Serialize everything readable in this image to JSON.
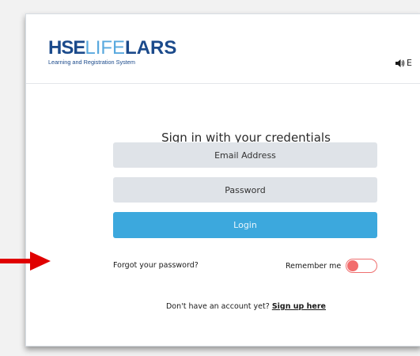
{
  "header": {
    "logo_part1": "HSE",
    "logo_part2": "LIFE",
    "logo_part3": "LARS",
    "logo_subtitle": "Learning and Registration System",
    "language_label": "E"
  },
  "login": {
    "heading": "Sign in with your credentials",
    "email_placeholder": "Email Address",
    "password_placeholder": "Password",
    "login_label": "Login",
    "forgot_label": "Forgot your password?",
    "remember_label": "Remember me",
    "remember_on": false,
    "signup_prompt": "Don't have an account yet?",
    "signup_link": "Sign up here"
  },
  "colors": {
    "logo_dark": "#1b4a8b",
    "logo_light": "#59a9de",
    "primary_button": "#3ca8dd",
    "field_bg": "#dfe3e8",
    "toggle": "#f26d6d",
    "annotation_arrow": "#e00000"
  },
  "icons": {
    "language": "speaker-icon",
    "annotation": "red-arrow-annotation"
  }
}
